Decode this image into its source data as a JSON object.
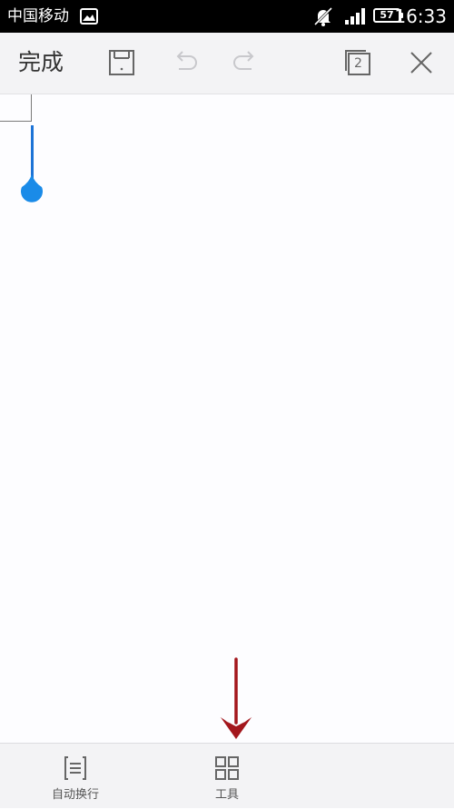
{
  "colors": {
    "status_bar_bg": "#000000",
    "toolbar_bg": "#f3f3f5",
    "document_bg": "#fdfdff",
    "cursor_blue": "#1d73d6",
    "handle_blue": "#1a8be8",
    "arrow_red": "#a3161c",
    "icon_gray": "#666666",
    "disabled_icon_gray": "#c8c8cc"
  },
  "status_bar": {
    "carrier": "中国移动",
    "battery": "57",
    "time": "16:33",
    "icons": [
      "gallery-notification-icon",
      "mute-icon",
      "signal-icon",
      "battery-icon"
    ]
  },
  "toolbar": {
    "done_label": "完成",
    "page_count": "2",
    "icons": [
      "save-icon",
      "undo-icon",
      "redo-icon",
      "page-switch-icon",
      "close-icon"
    ]
  },
  "bottom_bar": {
    "wrap_label": "自动换行",
    "tools_label": "工具",
    "icons": [
      "auto-wrap-icon",
      "tools-grid-icon"
    ]
  },
  "annotation": {
    "icon": "red-down-arrow"
  }
}
